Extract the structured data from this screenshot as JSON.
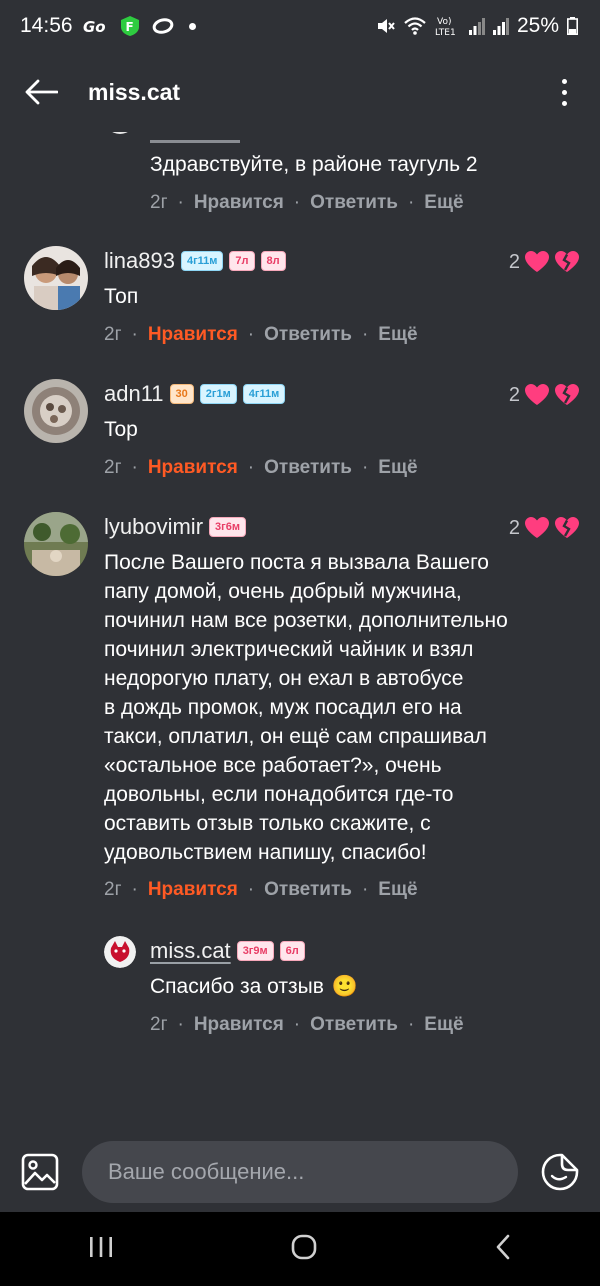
{
  "status_bar": {
    "time": "14:56",
    "battery": "25%",
    "network": "Vo) LTE1"
  },
  "header": {
    "title": "miss.cat"
  },
  "comments": [
    {
      "text": "Здравствуйте, в районе таугуль 2",
      "age": "2г",
      "like": "Нравится",
      "reply": "Ответить",
      "more": "Ещё"
    },
    {
      "username": "lina893",
      "badges": [
        "4г11м",
        "7л",
        "8л"
      ],
      "likes": "2",
      "text": "Топ",
      "age": "2г",
      "like": "Нравится",
      "reply": "Ответить",
      "more": "Ещё"
    },
    {
      "username": "adn11",
      "badges": [
        "30",
        "2г1м",
        "4г11м"
      ],
      "likes": "2",
      "text": "Top",
      "age": "2г",
      "like": "Нравится",
      "reply": "Ответить",
      "more": "Ещё"
    },
    {
      "username": "lyubovimir",
      "badges": [
        "3г6м"
      ],
      "likes": "2",
      "lines": [
        "После Вашего поста я вызвала Вашего",
        "папу домой, очень добрый мужчина,",
        "починил нам все розетки, дополнительно",
        "починил электрический чайник и взял",
        "недорогую плату, он ехал в автобусе",
        "в дождь промок, муж посадил его на",
        "такси, оплатил, он ещё сам спрашивал",
        "«остальное все работает?», очень",
        "довольны, если понадобится где-то",
        "оставить отзыв только скажите, с",
        "удовольствием напишу, спасибо!"
      ],
      "age": "2г",
      "like": "Нравится",
      "reply": "Ответить",
      "more": "Ещё"
    },
    {
      "username": "miss.cat",
      "badges": [
        "3г9м",
        "6л"
      ],
      "text": "Спасибо за отзыв",
      "emoji": "🙂",
      "age": "2г",
      "like": "Нравится",
      "reply": "Ответить",
      "more": "Ещё"
    }
  ],
  "input": {
    "placeholder": "Ваше сообщение..."
  },
  "colors": {
    "background": "#2f3136",
    "liked_accent": "#ff5a24",
    "heart": "#ff3d7f"
  }
}
